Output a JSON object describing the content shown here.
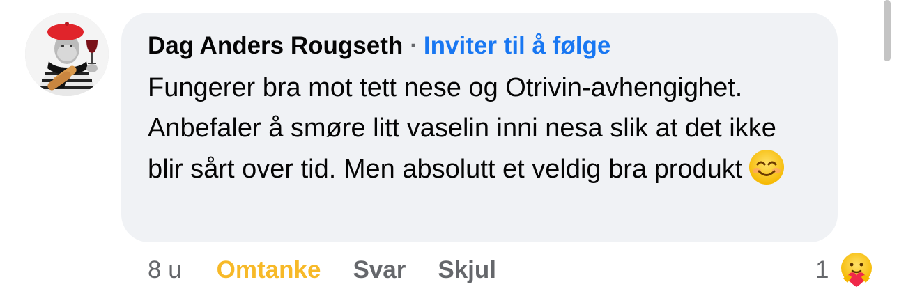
{
  "comment": {
    "author": "Dag Anders Rougseth",
    "separator": "·",
    "follow_label": "Inviter til å følge",
    "text": "Fungerer bra mot tett nese og Otrivin-avhengighet. Anbefaler å smøre litt vaselin inni nesa slik at det ikke blir sårt over tid. Men absolutt et veldig bra produkt",
    "emoji": "smiling-face-emoji",
    "time": "8 u",
    "actions": {
      "care_label": "Omtanke",
      "reply_label": "Svar",
      "hide_label": "Skjul"
    },
    "reaction_count": "1",
    "reaction_icon": "care-reaction-icon"
  },
  "colors": {
    "bubble": "#f0f2f5",
    "link": "#1877f2",
    "care": "#f7b928",
    "muted": "#65676b"
  }
}
